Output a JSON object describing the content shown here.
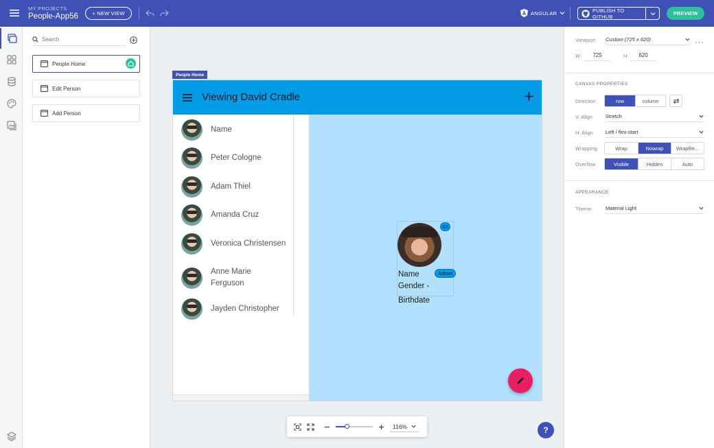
{
  "topbar": {
    "project_kicker": "MY PROJECTS",
    "project_name": "People-App56",
    "new_view_label": "+ NEW VIEW",
    "framework_label": "ANGULAR",
    "publish_label": "PUBLISH TO GITHUB",
    "preview_label": "PREVIEW"
  },
  "views_panel": {
    "search_placeholder": "Search",
    "items": [
      {
        "label": "People Home",
        "active": true
      },
      {
        "label": "Edit Person",
        "active": false
      },
      {
        "label": "Add Person",
        "active": false
      }
    ]
  },
  "canvas": {
    "view_tag": "People Home",
    "app_title": "Viewing David Cradle",
    "people": [
      {
        "name": "Name"
      },
      {
        "name": "Peter Cologne"
      },
      {
        "name": "Adam Thiel"
      },
      {
        "name": "Amanda Cruz"
      },
      {
        "name": "Veronica Christensen"
      },
      {
        "name": "Anne Marie Ferguson"
      },
      {
        "name": "Jayden Christopher"
      }
    ],
    "card": {
      "age_badge": "65",
      "role_badge": "Admin",
      "line1": "Name",
      "line2": "Gender -",
      "line3": "Birthdate"
    },
    "zoom": {
      "value_label": "116%",
      "slider_fraction": 0.3
    },
    "help_label": "?"
  },
  "properties": {
    "viewport_label": "Viewport",
    "viewport_value": "Custom (725 x 620)",
    "w_label": "W",
    "w_value": "725",
    "h_label": "H",
    "h_value": "620",
    "canvas_section": "CANVAS PROPERTIES",
    "direction_label": "Direction",
    "direction_options": [
      "row",
      "column"
    ],
    "valign_label": "V. Align",
    "valign_value": "Stretch",
    "halign_label": "H. Align",
    "halign_value": "Left / flex-start",
    "wrapping_label": "Wrapping",
    "wrapping_options": [
      "Wrap",
      "Nowrap",
      "WrapRe..."
    ],
    "overflow_label": "Overflow",
    "overflow_options": [
      "Visible",
      "Hidden",
      "Auto"
    ],
    "appearance_section": "APPEARANCE",
    "theme_label": "Theme",
    "theme_value": "Material Light"
  },
  "colors": {
    "brand": "#3f51b5",
    "appbar": "#039be5",
    "detail_bg": "#b3e0fc",
    "fab": "#e91e63",
    "preview": "#2ec09a"
  }
}
